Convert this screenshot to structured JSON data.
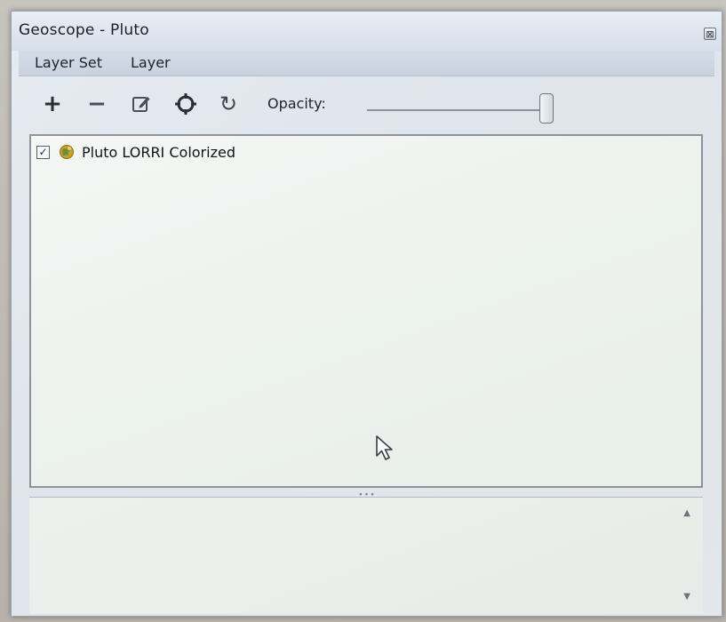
{
  "window": {
    "title": "Geoscope - Pluto",
    "close_glyph": "⊠"
  },
  "menubar": {
    "items": [
      {
        "label": "Layer Set"
      },
      {
        "label": "Layer"
      }
    ]
  },
  "toolbar": {
    "add_glyph": "+",
    "remove_glyph": "−",
    "refresh_glyph": "↻",
    "opacity_label": "Opacity:",
    "opacity_value": 1.0
  },
  "layers": [
    {
      "label": "Pluto LORRI Colorized",
      "checked": true,
      "check_glyph": "✓",
      "icon": "layer-globe-icon"
    }
  ],
  "splitter": {
    "grip_glyph": "∙∙∙"
  },
  "detail_panel": {
    "scroll_up_glyph": "▲",
    "scroll_down_glyph": "▼"
  },
  "colors": {
    "panel_bg": "#eef2ee",
    "icon_gold": "#c9a227"
  }
}
